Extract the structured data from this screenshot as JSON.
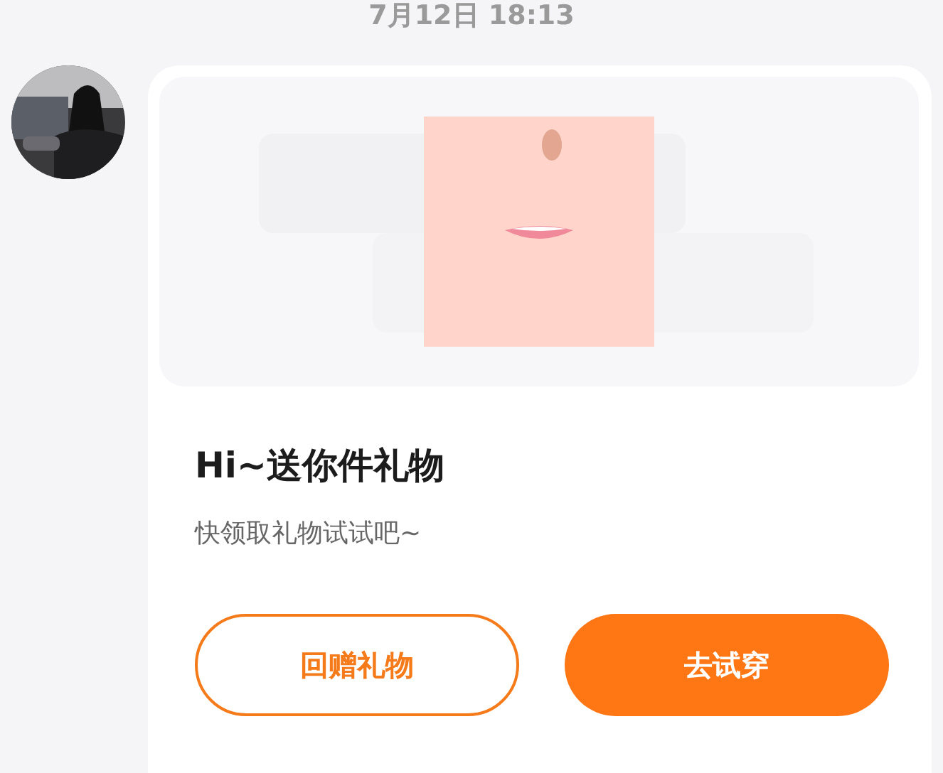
{
  "timestamp": "7月12日 18:13",
  "message": {
    "card": {
      "title": "Hi~送你件礼物",
      "subtitle": "快领取礼物试试吧~",
      "buttons": [
        {
          "label": "回赠礼物",
          "kind": "outline"
        },
        {
          "label": "去试穿",
          "kind": "filled"
        }
      ]
    }
  }
}
